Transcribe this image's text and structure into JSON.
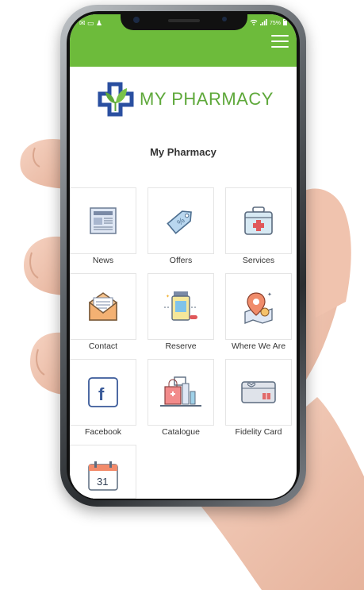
{
  "status_bar": {
    "left_icons": "✉ ▭ ♟",
    "right_text": "75%"
  },
  "header": {
    "brand": "MY PHARMACY",
    "title": "My Pharmacy"
  },
  "tiles": [
    {
      "label": "News",
      "icon": "newspaper-icon"
    },
    {
      "label": "Offers",
      "icon": "tag-icon"
    },
    {
      "label": "Services",
      "icon": "first-aid-kit-icon"
    },
    {
      "label": "Contact",
      "icon": "envelope-icon"
    },
    {
      "label": "Reserve",
      "icon": "medicine-bottle-icon"
    },
    {
      "label": "Where We Are",
      "icon": "map-pin-icon"
    },
    {
      "label": "Facebook",
      "icon": "facebook-icon"
    },
    {
      "label": "Catalogue",
      "icon": "shopping-bag-icon"
    },
    {
      "label": "Fidelity Card",
      "icon": "gift-card-icon"
    },
    {
      "label": "",
      "icon": "calendar-icon",
      "value": "31"
    }
  ],
  "colors": {
    "accent": "#6dbb3b",
    "logo_blue": "#2a4fa0",
    "logo_green": "#5ea83a"
  }
}
